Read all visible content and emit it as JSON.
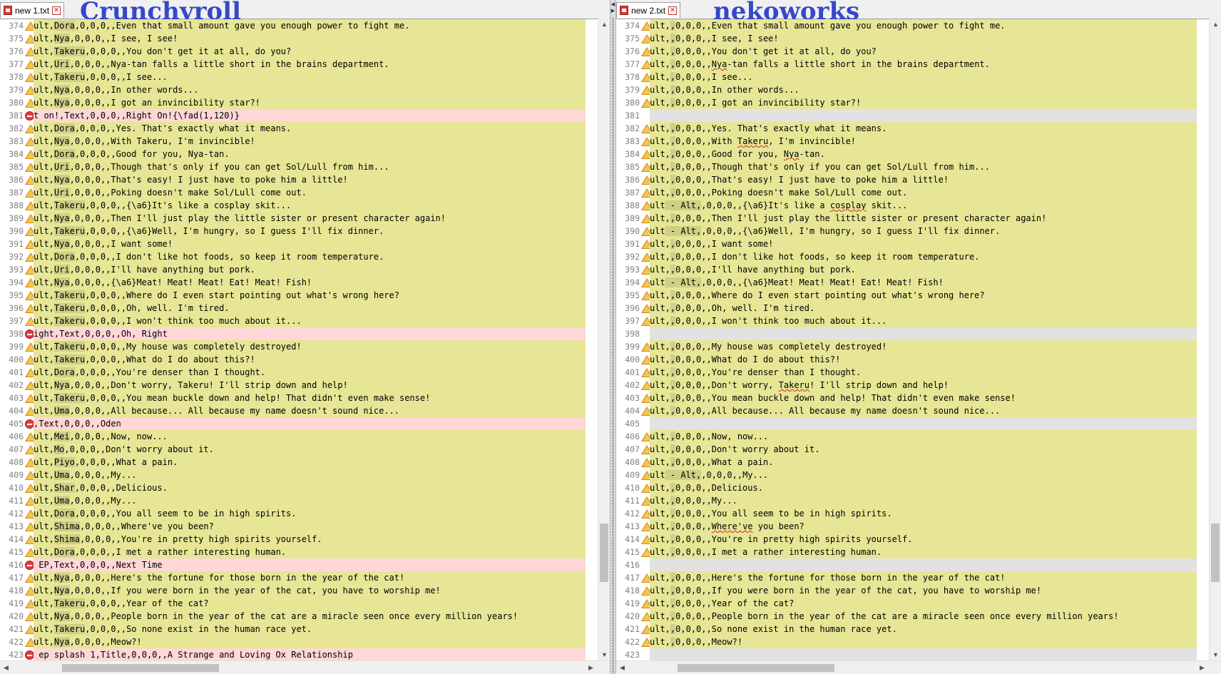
{
  "left": {
    "tab_label": "new  1.txt",
    "caption": "Crunchyroll",
    "rows": [
      {
        "n": "374",
        "s": "c",
        "p": "ult,",
        "f": "Dora",
        "t": ",0,0,0,,Even that small amount gave you enough power to fight me."
      },
      {
        "n": "375",
        "s": "c",
        "p": "ult,",
        "f": "Nya",
        "t": ",0,0,0,,I see, I see!"
      },
      {
        "n": "376",
        "s": "c",
        "p": "ult,",
        "f": "Takeru",
        "t": ",0,0,0,,You don't get it at all, do you?"
      },
      {
        "n": "377",
        "s": "c",
        "p": "ult,",
        "f": "Uri",
        "t": ",0,0,0,,Nya-tan falls a little short in the brains department."
      },
      {
        "n": "378",
        "s": "c",
        "p": "ult,",
        "f": "Takeru",
        "t": ",0,0,0,,I see..."
      },
      {
        "n": "379",
        "s": "c",
        "p": "ult,",
        "f": "Nya",
        "t": ",0,0,0,,In other words..."
      },
      {
        "n": "380",
        "s": "c",
        "p": "ult,",
        "f": "Nya",
        "t": ",0,0,0,,I got an invincibility star?!"
      },
      {
        "n": "381",
        "s": "d",
        "p": "t on!,Text,0,0,0,,Right On!{\\fad(1,120)}",
        "f": "",
        "t": ""
      },
      {
        "n": "382",
        "s": "c",
        "p": "ult,",
        "f": "Dora",
        "t": ",0,0,0,,Yes. That's exactly what it means."
      },
      {
        "n": "383",
        "s": "c",
        "p": "ult,",
        "f": "Nya",
        "t": ",0,0,0,,With Takeru, I'm invincible!"
      },
      {
        "n": "384",
        "s": "c",
        "p": "ult,",
        "f": "Dora",
        "t": ",0,0,0,,Good for you, Nya-tan."
      },
      {
        "n": "385",
        "s": "c",
        "p": "ult,",
        "f": "Uri",
        "t": ",0,0,0,,Though that's only if you can get Sol/Lull from him..."
      },
      {
        "n": "386",
        "s": "c",
        "p": "ult,",
        "f": "Nya",
        "t": ",0,0,0,,That's easy! I just have to poke him a little!"
      },
      {
        "n": "387",
        "s": "c",
        "p": "ult,",
        "f": "Uri",
        "t": ",0,0,0,,Poking doesn't make Sol/Lull come out."
      },
      {
        "n": "388",
        "s": "c",
        "p": "ult,",
        "f": "Takeru",
        "t": ",0,0,0,,{\\a6}It's like a cosplay skit..."
      },
      {
        "n": "389",
        "s": "c",
        "p": "ult,",
        "f": "Nya",
        "t": ",0,0,0,,Then I'll just play the little sister or present character again!"
      },
      {
        "n": "390",
        "s": "c",
        "p": "ult,",
        "f": "Takeru",
        "t": ",0,0,0,,{\\a6}Well, I'm hungry, so I guess I'll fix dinner."
      },
      {
        "n": "391",
        "s": "c",
        "p": "ult,",
        "f": "Nya",
        "t": ",0,0,0,,I want some!"
      },
      {
        "n": "392",
        "s": "c",
        "p": "ult,",
        "f": "Dora",
        "t": ",0,0,0,,I don't like hot foods, so keep it room temperature."
      },
      {
        "n": "393",
        "s": "c",
        "p": "ult,",
        "f": "Uri",
        "t": ",0,0,0,,I'll have anything but pork."
      },
      {
        "n": "394",
        "s": "c",
        "p": "ult,",
        "f": "Nya",
        "t": ",0,0,0,,{\\a6}Meat! Meat! Meat! Eat! Meat! Fish!"
      },
      {
        "n": "395",
        "s": "c",
        "p": "ult,",
        "f": "Takeru",
        "t": ",0,0,0,,Where do I even start pointing out what's wrong here?"
      },
      {
        "n": "396",
        "s": "c",
        "p": "ult,",
        "f": "Takeru",
        "t": ",0,0,0,,Oh, well. I'm tired."
      },
      {
        "n": "397",
        "s": "c",
        "p": "ult,",
        "f": "Takeru",
        "t": ",0,0,0,,I won't think too much about it..."
      },
      {
        "n": "398",
        "s": "d",
        "p": "ight,Text,0,0,0,,Oh, Right",
        "f": "",
        "t": ""
      },
      {
        "n": "399",
        "s": "c",
        "p": "ult,",
        "f": "Takeru",
        "t": ",0,0,0,,My house was completely destroyed!"
      },
      {
        "n": "400",
        "s": "c",
        "p": "ult,",
        "f": "Takeru",
        "t": ",0,0,0,,What do I do about this?!"
      },
      {
        "n": "401",
        "s": "c",
        "p": "ult,",
        "f": "Dora",
        "t": ",0,0,0,,You're denser than I thought."
      },
      {
        "n": "402",
        "s": "c",
        "p": "ult,",
        "f": "Nya",
        "t": ",0,0,0,,Don't worry, Takeru! I'll strip down and help!"
      },
      {
        "n": "403",
        "s": "c",
        "p": "ult,",
        "f": "Takeru",
        "t": ",0,0,0,,You mean buckle down and help! That didn't even make sense!"
      },
      {
        "n": "404",
        "s": "c",
        "p": "ult,",
        "f": "Uma",
        "t": ",0,0,0,,All because... All because my name doesn't sound nice..."
      },
      {
        "n": "405",
        "s": "d",
        "p": ",Text,0,0,0,,Oden",
        "f": "",
        "t": ""
      },
      {
        "n": "406",
        "s": "c",
        "p": "ult,",
        "f": "Mei",
        "t": ",0,0,0,,Now, now..."
      },
      {
        "n": "407",
        "s": "c",
        "p": "ult,",
        "f": "Mo",
        "t": ",0,0,0,,Don't worry about it."
      },
      {
        "n": "408",
        "s": "c",
        "p": "ult,",
        "f": "Piyo",
        "t": ",0,0,0,,What a pain."
      },
      {
        "n": "409",
        "s": "c",
        "p": "ult,",
        "f": "Uma",
        "t": ",0,0,0,,My..."
      },
      {
        "n": "410",
        "s": "c",
        "p": "ult,",
        "f": "Shar",
        "t": ",0,0,0,,Delicious."
      },
      {
        "n": "411",
        "s": "c",
        "p": "ult,",
        "f": "Uma",
        "t": ",0,0,0,,My..."
      },
      {
        "n": "412",
        "s": "c",
        "p": "ult,",
        "f": "Dora",
        "t": ",0,0,0,,You all seem to be in high spirits."
      },
      {
        "n": "413",
        "s": "c",
        "p": "ult,",
        "f": "Shima",
        "t": ",0,0,0,,Where've you been?"
      },
      {
        "n": "414",
        "s": "c",
        "p": "ult,",
        "f": "Shima",
        "t": ",0,0,0,,You're in pretty high spirits yourself."
      },
      {
        "n": "415",
        "s": "c",
        "p": "ult,",
        "f": "Dora",
        "t": ",0,0,0,,I met a rather interesting human."
      },
      {
        "n": "416",
        "s": "d",
        "p": " EP,Text,0,0,0,,Next Time",
        "f": "",
        "t": ""
      },
      {
        "n": "417",
        "s": "c",
        "p": "ult,",
        "f": "Nya",
        "t": ",0,0,0,,Here's the fortune for those born in the year of the cat!"
      },
      {
        "n": "418",
        "s": "c",
        "p": "ult,",
        "f": "Nya",
        "t": ",0,0,0,,If you were born in the year of the cat, you have to worship me!"
      },
      {
        "n": "419",
        "s": "c",
        "p": "ult,",
        "f": "Takeru",
        "t": ",0,0,0,,Year of the cat?"
      },
      {
        "n": "420",
        "s": "c",
        "p": "ult,",
        "f": "Nya",
        "t": ",0,0,0,,People born in the year of the cat are a miracle seen once every million years!"
      },
      {
        "n": "421",
        "s": "c",
        "p": "ult,",
        "f": "Takeru",
        "t": ",0,0,0,,So none exist in the human race yet."
      },
      {
        "n": "422",
        "s": "c",
        "p": "ult,",
        "f": "Nya",
        "t": ",0,0,0,,Meow?!"
      },
      {
        "n": "423",
        "s": "d",
        "p": " ep splash 1,Title,0,0,0,,A Strange and Loving Ox Relationship",
        "f": "",
        "t": ""
      }
    ]
  },
  "right": {
    "tab_label": "new  2.txt",
    "caption": "nekoworks",
    "rows": [
      {
        "n": "374",
        "s": "c",
        "p": "ult,",
        "f": ",",
        "t": "0,0,0,,Even that small amount gave you enough power to fight me."
      },
      {
        "n": "375",
        "s": "c",
        "p": "ult,",
        "f": ",",
        "t": "0,0,0,,I see, I see!"
      },
      {
        "n": "376",
        "s": "c",
        "p": "ult,",
        "f": ",",
        "t": "0,0,0,,You don't get it at all, do you?"
      },
      {
        "n": "377",
        "s": "c",
        "p": "ult,",
        "f": ",",
        "t": "0,0,0,,Nya-tan falls a little short in the brains department."
      },
      {
        "n": "378",
        "s": "c",
        "p": "ult,",
        "f": ",",
        "t": "0,0,0,,I see..."
      },
      {
        "n": "379",
        "s": "c",
        "p": "ult,",
        "f": ",",
        "t": "0,0,0,,In other words..."
      },
      {
        "n": "380",
        "s": "c",
        "p": "ult,",
        "f": ",",
        "t": "0,0,0,,I got an invincibility star?!"
      },
      {
        "n": "381",
        "s": "b",
        "p": "",
        "f": "",
        "t": ""
      },
      {
        "n": "382",
        "s": "c",
        "p": "ult,",
        "f": ",",
        "t": "0,0,0,,Yes. That's exactly what it means."
      },
      {
        "n": "383",
        "s": "c",
        "p": "ult,",
        "f": ",",
        "t": "0,0,0,,With Takeru, I'm invincible!"
      },
      {
        "n": "384",
        "s": "c",
        "p": "ult,",
        "f": ",",
        "t": "0,0,0,,Good for you, Nya-tan."
      },
      {
        "n": "385",
        "s": "c",
        "p": "ult,",
        "f": ",",
        "t": "0,0,0,,Though that's only if you can get Sol/Lull from him..."
      },
      {
        "n": "386",
        "s": "c",
        "p": "ult,",
        "f": ",",
        "t": "0,0,0,,That's easy! I just have to poke him a little!"
      },
      {
        "n": "387",
        "s": "c",
        "p": "ult,",
        "f": ",",
        "t": "0,0,0,,Poking doesn't make Sol/Lull come out."
      },
      {
        "n": "388",
        "s": "c",
        "p": "ult",
        "f": " - Alt,",
        "t": ",0,0,0,,{\\a6}It's like a cosplay skit..."
      },
      {
        "n": "389",
        "s": "c",
        "p": "ult,",
        "f": ",",
        "t": "0,0,0,,Then I'll just play the little sister or present character again!"
      },
      {
        "n": "390",
        "s": "c",
        "p": "ult",
        "f": " - Alt,",
        "t": ",0,0,0,,{\\a6}Well, I'm hungry, so I guess I'll fix dinner."
      },
      {
        "n": "391",
        "s": "c",
        "p": "ult,",
        "f": ",",
        "t": "0,0,0,,I want some!"
      },
      {
        "n": "392",
        "s": "c",
        "p": "ult,",
        "f": ",",
        "t": "0,0,0,,I don't like hot foods, so keep it room temperature."
      },
      {
        "n": "393",
        "s": "c",
        "p": "ult,",
        "f": ",",
        "t": "0,0,0,,I'll have anything but pork."
      },
      {
        "n": "394",
        "s": "c",
        "p": "ult",
        "f": " - Alt,",
        "t": ",0,0,0,,{\\a6}Meat! Meat! Meat! Eat! Meat! Fish!"
      },
      {
        "n": "395",
        "s": "c",
        "p": "ult,",
        "f": ",",
        "t": "0,0,0,,Where do I even start pointing out what's wrong here?"
      },
      {
        "n": "396",
        "s": "c",
        "p": "ult,",
        "f": ",",
        "t": "0,0,0,,Oh, well. I'm tired."
      },
      {
        "n": "397",
        "s": "c",
        "p": "ult,",
        "f": ",",
        "t": "0,0,0,,I won't think too much about it..."
      },
      {
        "n": "398",
        "s": "b",
        "p": "",
        "f": "",
        "t": ""
      },
      {
        "n": "399",
        "s": "c",
        "p": "ult,",
        "f": ",",
        "t": "0,0,0,,My house was completely destroyed!"
      },
      {
        "n": "400",
        "s": "c",
        "p": "ult,",
        "f": ",",
        "t": "0,0,0,,What do I do about this?!"
      },
      {
        "n": "401",
        "s": "c",
        "p": "ult,",
        "f": ",",
        "t": "0,0,0,,You're denser than I thought."
      },
      {
        "n": "402",
        "s": "c",
        "p": "ult,",
        "f": ",",
        "t": "0,0,0,,Don't worry, Takeru! I'll strip down and help!"
      },
      {
        "n": "403",
        "s": "c",
        "p": "ult,",
        "f": ",",
        "t": "0,0,0,,You mean buckle down and help! That didn't even make sense!"
      },
      {
        "n": "404",
        "s": "c",
        "p": "ult,",
        "f": ",",
        "t": "0,0,0,,All because... All because my name doesn't sound nice..."
      },
      {
        "n": "405",
        "s": "b",
        "p": "",
        "f": "",
        "t": ""
      },
      {
        "n": "406",
        "s": "c",
        "p": "ult,",
        "f": ",",
        "t": "0,0,0,,Now, now..."
      },
      {
        "n": "407",
        "s": "c",
        "p": "ult,",
        "f": ",",
        "t": "0,0,0,,Don't worry about it."
      },
      {
        "n": "408",
        "s": "c",
        "p": "ult,",
        "f": ",",
        "t": "0,0,0,,What a pain."
      },
      {
        "n": "409",
        "s": "c",
        "p": "ult",
        "f": " - Alt,",
        "t": ",0,0,0,,My..."
      },
      {
        "n": "410",
        "s": "c",
        "p": "ult,",
        "f": ",",
        "t": "0,0,0,,Delicious."
      },
      {
        "n": "411",
        "s": "c",
        "p": "ult,",
        "f": ",",
        "t": "0,0,0,,My..."
      },
      {
        "n": "412",
        "s": "c",
        "p": "ult,",
        "f": ",",
        "t": "0,0,0,,You all seem to be in high spirits."
      },
      {
        "n": "413",
        "s": "c",
        "p": "ult,",
        "f": ",",
        "t": "0,0,0,,Where've you been?"
      },
      {
        "n": "414",
        "s": "c",
        "p": "ult,",
        "f": ",",
        "t": "0,0,0,,You're in pretty high spirits yourself."
      },
      {
        "n": "415",
        "s": "c",
        "p": "ult,",
        "f": ",",
        "t": "0,0,0,,I met a rather interesting human."
      },
      {
        "n": "416",
        "s": "b",
        "p": "",
        "f": "",
        "t": ""
      },
      {
        "n": "417",
        "s": "c",
        "p": "ult,",
        "f": ",",
        "t": "0,0,0,,Here's the fortune for those born in the year of the cat!"
      },
      {
        "n": "418",
        "s": "c",
        "p": "ult,",
        "f": ",",
        "t": "0,0,0,,If you were born in the year of the cat, you have to worship me!"
      },
      {
        "n": "419",
        "s": "c",
        "p": "ult,",
        "f": ",",
        "t": "0,0,0,,Year of the cat?"
      },
      {
        "n": "420",
        "s": "c",
        "p": "ult,",
        "f": ",",
        "t": "0,0,0,,People born in the year of the cat are a miracle seen once every million years!"
      },
      {
        "n": "421",
        "s": "c",
        "p": "ult,",
        "f": ",",
        "t": "0,0,0,,So none exist in the human race yet."
      },
      {
        "n": "422",
        "s": "c",
        "p": "ult,",
        "f": ",",
        "t": "0,0,0,,Meow?!"
      },
      {
        "n": "423",
        "s": "b",
        "p": "",
        "f": "",
        "t": ""
      }
    ]
  },
  "scroll": {
    "left_vertical_position": 0.88,
    "right_vertical_position": 0.88,
    "left_horizontal_position": 0.12,
    "right_horizontal_position": 0.12
  },
  "colors": {
    "changed": "#e6e696",
    "deleted": "#ffd7d7",
    "blank": "#e2e2e2",
    "caption": "#3548c9",
    "warning": "#f6c550",
    "removed": "#e23b3b"
  },
  "icons": {
    "changed_marker": "warning-icon",
    "deleted_marker": "minus-circle-icon",
    "tab": "file-icon",
    "tab_close": "close-icon"
  }
}
